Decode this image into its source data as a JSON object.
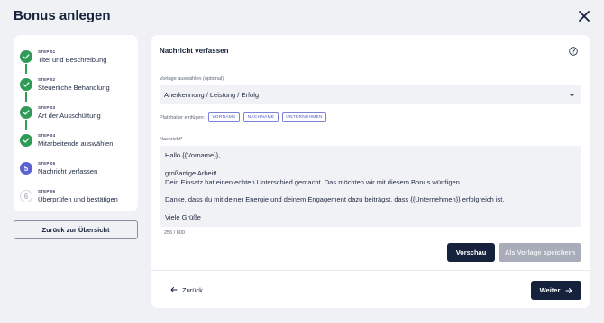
{
  "page": {
    "title": "Bonus anlegen"
  },
  "stepper": {
    "steps": [
      {
        "small": "STEP 01",
        "label": "Titel und Beschreibung",
        "state": "done"
      },
      {
        "small": "STEP 02",
        "label": "Steuerliche Behandlung",
        "state": "done"
      },
      {
        "small": "STEP 03",
        "label": "Art der Ausschüttung",
        "state": "done"
      },
      {
        "small": "STEP 04",
        "label": "Mitarbeitende auswählen",
        "state": "done"
      },
      {
        "small": "STEP 05",
        "label": "Nachricht verfassen",
        "state": "active",
        "number": "5"
      },
      {
        "small": "STEP 06",
        "label": "Überprüfen und bestätigen",
        "state": "todo",
        "number": "6"
      }
    ],
    "back_label": "Zurück zur Übersicht"
  },
  "main": {
    "title": "Nachricht verfassen",
    "template_label": "Vorlage auswählen (optional)",
    "template_value": "Anerkennung / Leistung / Erfolg",
    "placeholders_label": "Platzhalter einfügen:",
    "chips": [
      "VORNAME",
      "NACHNAME",
      "UNTERNEHMEN"
    ],
    "message_label": "Nachricht*",
    "message_lines": [
      "Hallo {{Vorname}},",
      "",
      "großartige Arbeit!",
      "Dein Einsatz hat einen echten Unterschied gemacht. Das möchten wir mit diesem Bonus würdigen.",
      "",
      "Danke, dass du mit deiner Energie und deinem Engagement dazu beiträgst, dass {{Unternehmen}} erfolgreich ist.",
      "",
      "Viele Grüße"
    ],
    "char_count": "256 / 800",
    "preview_label": "Vorschau",
    "save_template_label": "Als Vorlage speichern",
    "back_label": "Zurück",
    "next_label": "Weiter"
  },
  "icons": {
    "close": "close-icon",
    "check": "check-icon",
    "help": "help-circle-icon",
    "chevron": "chevron-down-icon",
    "arrow_left": "arrow-left-icon",
    "arrow_right": "arrow-right-icon"
  },
  "colors": {
    "primary": "#16223b",
    "success": "#2e9b57",
    "active_step": "#5b63d3",
    "chip_border": "#7b82d8",
    "disabled_button": "#a8adb9",
    "background": "#f0f1f5"
  }
}
